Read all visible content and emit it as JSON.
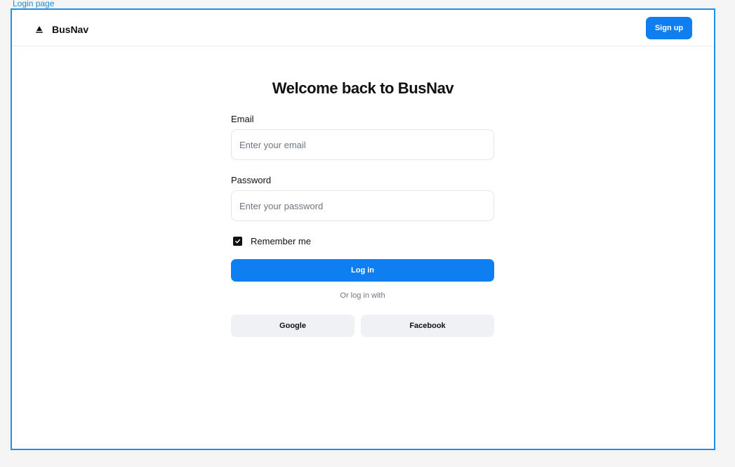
{
  "canvas": {
    "frame_label": "Login page"
  },
  "header": {
    "brand_name": "BusNav",
    "brand_icon": "sail-icon",
    "signup_label": "Sign up"
  },
  "login": {
    "title": "Welcome back to BusNav",
    "email": {
      "label": "Email",
      "placeholder": "Enter your email",
      "value": ""
    },
    "password": {
      "label": "Password",
      "placeholder": "Enter your password",
      "value": ""
    },
    "remember": {
      "label": "Remember me",
      "checked": true
    },
    "submit_label": "Log in",
    "alt_login_text": "Or log in with",
    "social": [
      {
        "label": "Google"
      },
      {
        "label": "Facebook"
      }
    ]
  },
  "colors": {
    "accent": "#0f7ef0",
    "frame_border": "#1e90e6",
    "background": "#f5f5f5",
    "social_button_bg": "#f0f1f4",
    "text_primary": "#111111",
    "text_muted": "#6f7680"
  }
}
